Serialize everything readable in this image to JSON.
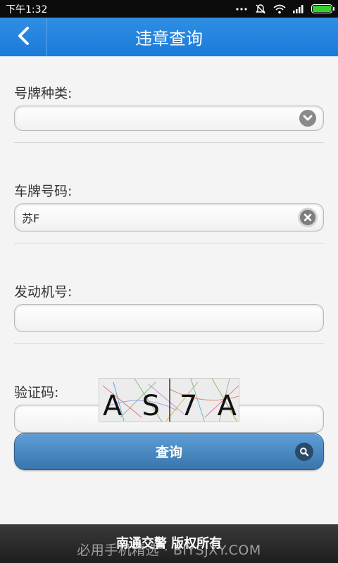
{
  "status_bar": {
    "time": "下午1:32",
    "icons": [
      "more-icon",
      "notifications-muted-icon",
      "wifi-icon",
      "signal-icon",
      "battery-icon"
    ],
    "battery_color": "#36d12f"
  },
  "header": {
    "title": "违章查询",
    "back_icon": "chevron-left-icon",
    "color": "#1a7ad9"
  },
  "form": {
    "plate_type": {
      "label": "号牌种类:",
      "value": ""
    },
    "plate_number": {
      "label": "车牌号码:",
      "value": "苏F"
    },
    "engine_number": {
      "label": "发动机号:",
      "value": ""
    },
    "verify_code": {
      "label": "验证码:",
      "value": ""
    }
  },
  "captcha": {
    "text": "AS7A"
  },
  "query_button": {
    "label": "查询",
    "icon": "search-icon",
    "color": "#3a75ad"
  },
  "footer": {
    "copyright": "南通交警 版权所有",
    "watermark": "必用手机精选 · BIYSJXY.COM"
  }
}
